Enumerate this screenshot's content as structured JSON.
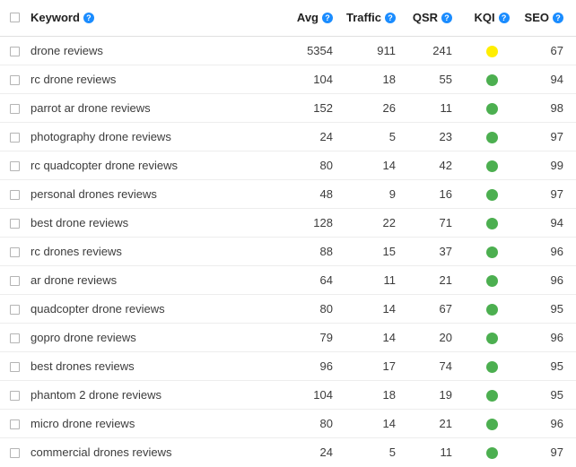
{
  "table": {
    "columns": [
      {
        "key": "check",
        "label": "",
        "help": false,
        "align": "left"
      },
      {
        "key": "keyword",
        "label": "Keyword",
        "help": true,
        "align": "left"
      },
      {
        "key": "avg",
        "label": "Avg",
        "help": true,
        "align": "right"
      },
      {
        "key": "traffic",
        "label": "Traffic",
        "help": true,
        "align": "right"
      },
      {
        "key": "qsr",
        "label": "QSR",
        "help": true,
        "align": "right"
      },
      {
        "key": "kqi",
        "label": "KQI",
        "help": true,
        "align": "center"
      },
      {
        "key": "seo",
        "label": "SEO",
        "help": true,
        "align": "right"
      }
    ],
    "help_icon_glyph": "?",
    "header_select_all_checked": false,
    "rows": [
      {
        "keyword": "drone reviews",
        "avg": "5354",
        "traffic": "911",
        "qsr": "241",
        "kqi": "yellow",
        "seo": "67",
        "checked": false
      },
      {
        "keyword": "rc drone reviews",
        "avg": "104",
        "traffic": "18",
        "qsr": "55",
        "kqi": "green",
        "seo": "94",
        "checked": false
      },
      {
        "keyword": "parrot ar drone reviews",
        "avg": "152",
        "traffic": "26",
        "qsr": "11",
        "kqi": "green",
        "seo": "98",
        "checked": false
      },
      {
        "keyword": "photography drone reviews",
        "avg": "24",
        "traffic": "5",
        "qsr": "23",
        "kqi": "green",
        "seo": "97",
        "checked": false
      },
      {
        "keyword": "rc quadcopter drone reviews",
        "avg": "80",
        "traffic": "14",
        "qsr": "42",
        "kqi": "green",
        "seo": "99",
        "checked": false
      },
      {
        "keyword": "personal drones reviews",
        "avg": "48",
        "traffic": "9",
        "qsr": "16",
        "kqi": "green",
        "seo": "97",
        "checked": false
      },
      {
        "keyword": "best drone reviews",
        "avg": "128",
        "traffic": "22",
        "qsr": "71",
        "kqi": "green",
        "seo": "94",
        "checked": false
      },
      {
        "keyword": "rc drones reviews",
        "avg": "88",
        "traffic": "15",
        "qsr": "37",
        "kqi": "green",
        "seo": "96",
        "checked": false
      },
      {
        "keyword": "ar drone reviews",
        "avg": "64",
        "traffic": "11",
        "qsr": "21",
        "kqi": "green",
        "seo": "96",
        "checked": false
      },
      {
        "keyword": "quadcopter drone reviews",
        "avg": "80",
        "traffic": "14",
        "qsr": "67",
        "kqi": "green",
        "seo": "95",
        "checked": false
      },
      {
        "keyword": "gopro drone reviews",
        "avg": "79",
        "traffic": "14",
        "qsr": "20",
        "kqi": "green",
        "seo": "96",
        "checked": false
      },
      {
        "keyword": "best drones reviews",
        "avg": "96",
        "traffic": "17",
        "qsr": "74",
        "kqi": "green",
        "seo": "95",
        "checked": false
      },
      {
        "keyword": "phantom 2 drone reviews",
        "avg": "104",
        "traffic": "18",
        "qsr": "19",
        "kqi": "green",
        "seo": "95",
        "checked": false
      },
      {
        "keyword": "micro drone reviews",
        "avg": "80",
        "traffic": "14",
        "qsr": "21",
        "kqi": "green",
        "seo": "96",
        "checked": false
      },
      {
        "keyword": "commercial drones reviews",
        "avg": "24",
        "traffic": "5",
        "qsr": "11",
        "kqi": "green",
        "seo": "97",
        "checked": false
      }
    ]
  },
  "colors": {
    "kqi_green": "#4caf50",
    "kqi_yellow": "#ffee00",
    "help_icon_blue": "#1a8cff",
    "header_text": "#212121",
    "body_text": "#3c3c3c",
    "row_divider": "#ededed",
    "header_divider": "#e0e0e0",
    "checkbox_border": "#b4b4b4",
    "background": "#ffffff"
  }
}
